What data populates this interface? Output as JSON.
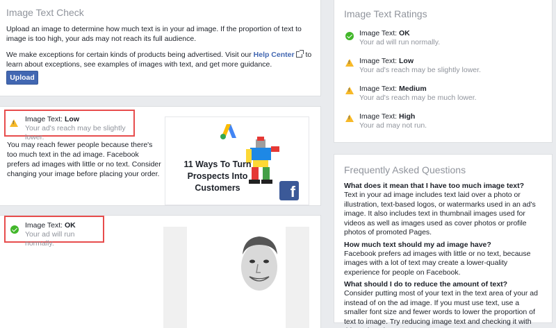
{
  "check": {
    "title": "Image Text Check",
    "intro": "Upload an image to determine how much text is in your ad image. If the proportion of text to image is too high, your ads may not reach its full audience.",
    "exceptions_before": "We make exceptions for certain kinds of products being advertised. Visit our",
    "help_center_link": "Help Center",
    "exceptions_after": "to learn about exceptions, see examples of images with text, and get more guidance.",
    "upload_label": "Upload"
  },
  "result_low": {
    "label": "Image Text:",
    "level": "Low",
    "sub": "Your ad's reach may be slightly lower.",
    "description": "You may reach fewer people because there's too much text in the ad image. Facebook prefers ad images with little or no text. Consider changing your image before placing your order.",
    "ad_text": "11 Ways To Turn Prospects Into Customers",
    "fb_letter": "f"
  },
  "result_ok": {
    "label": "Image Text:",
    "level": "OK",
    "sub": "Your ad will run normally."
  },
  "ratings": {
    "title": "Image Text Ratings",
    "items": [
      {
        "label": "Image Text:",
        "level": "OK",
        "sub": "Your ad will run normally.",
        "icon": "check-circle-icon"
      },
      {
        "label": "Image Text:",
        "level": "Low",
        "sub": "Your ad's reach may be slightly lower.",
        "icon": "warning-icon"
      },
      {
        "label": "Image Text:",
        "level": "Medium",
        "sub": "Your ad's reach may be much lower.",
        "icon": "warning-icon"
      },
      {
        "label": "Image Text:",
        "level": "High",
        "sub": "Your ad may not run.",
        "icon": "warning-icon"
      }
    ]
  },
  "faq": {
    "title": "Frequently Asked Questions",
    "items": [
      {
        "q": "What does it mean that I have too much image text?",
        "a": "Text in your ad image includes text laid over a photo or illustration, text-based logos, or watermarks used in an ad's image. It also includes text in thumbnail images used for videos as well as images used as cover photos or profile photos of promoted Pages."
      },
      {
        "q": "How much text should my ad image have?",
        "a": "Facebook prefers ad images with little or no text, because images with a lot of text may create a lower-quality experience for people on Facebook."
      },
      {
        "q": "What should I do to reduce the amount of text?",
        "a": "Consider putting most of your text in the text area of your ad instead of on the ad image. If you must use text, use a smaller font size and fewer words to lower the proportion of text to image. Try reducing image text and checking it with this tool again."
      }
    ]
  },
  "colors": {
    "primary": "#4267b2",
    "warning": "#f7b928",
    "ok": "#42b72a",
    "highlight_border": "#e74c4c"
  }
}
